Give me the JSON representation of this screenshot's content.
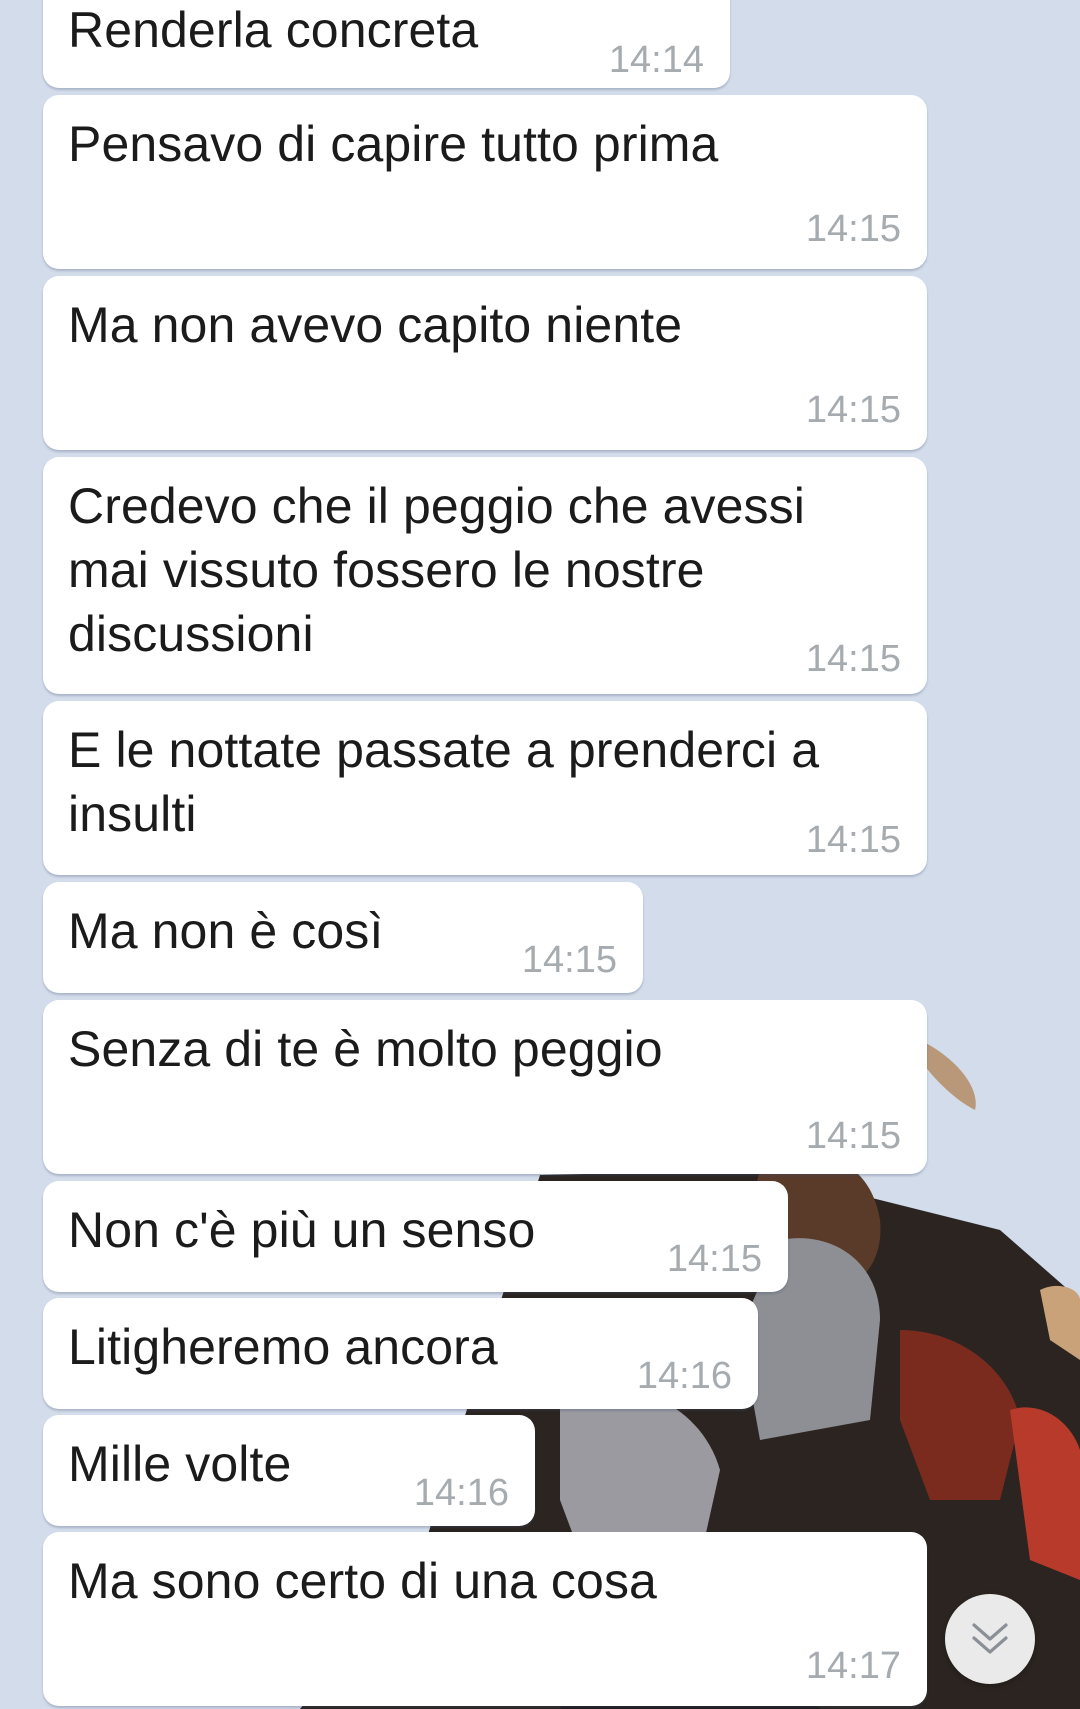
{
  "chat": {
    "messages": [
      {
        "text": "Renderla concreta",
        "time": "14:14"
      },
      {
        "text": "Pensavo di capire tutto prima",
        "time": "14:15"
      },
      {
        "text": "Ma non avevo capito niente",
        "time": "14:15"
      },
      {
        "text": "Credevo che il peggio che avessi\nmai vissuto fossero le nostre\ndiscussioni",
        "time": "14:15"
      },
      {
        "text": "E le nottate passate a prenderci a\ninsulti",
        "time": "14:15"
      },
      {
        "text": "Ma non è così",
        "time": "14:15"
      },
      {
        "text": "Senza di te è molto peggio",
        "time": "14:15"
      },
      {
        "text": "Non c'è più un senso",
        "time": "14:15"
      },
      {
        "text": "Litigheremo ancora",
        "time": "14:16"
      },
      {
        "text": "Mille volte",
        "time": "14:16"
      },
      {
        "text": "Ma sono certo di una cosa",
        "time": "14:17"
      }
    ]
  },
  "scroll_button": {
    "icon": "double-chevron-down-icon"
  },
  "colors": {
    "background": "#d3dcea",
    "bubble": "#ffffff",
    "text": "#1b1b1b",
    "timestamp": "#a6abb0"
  }
}
